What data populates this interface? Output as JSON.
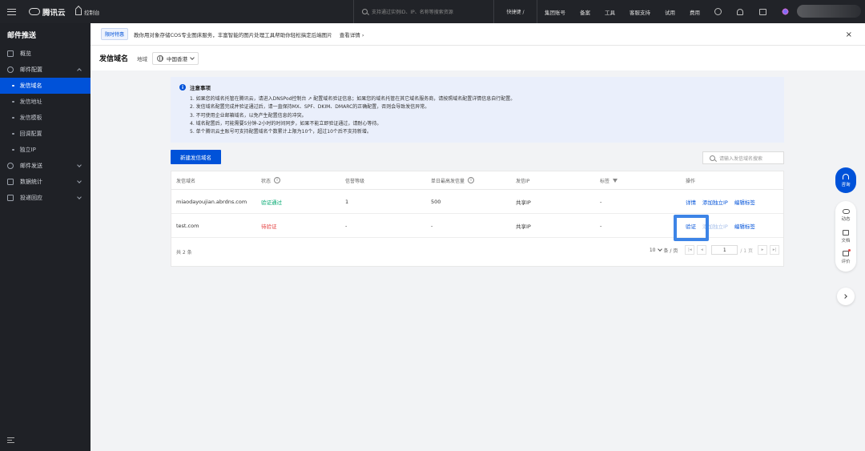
{
  "topbar": {
    "logo_text": "腾讯云",
    "console_label": "控制台",
    "search_placeholder": "支持通过实例ID、IP、名称等搜索资源",
    "user_label": "快捷键 /",
    "menu": [
      "集团账号",
      "备案",
      "工具",
      "客服支持",
      "试用",
      "费用"
    ]
  },
  "sidebar": {
    "title": "邮件推送",
    "items": {
      "overview": "概览",
      "mail_config": "邮件配置",
      "sub": [
        "发信域名",
        "发信地址",
        "发信模板",
        "回调配置"
      ],
      "dedicated_ip": "独立IP",
      "mail_send": "邮件发送",
      "data_stats": "数据统计",
      "delivery_reply": "投递回应"
    }
  },
  "notice": {
    "tag": "限时特惠",
    "text": "教你用对象存储COS专业图床服务，丰富智能的图片处理工具帮助你轻松搞定后端图片",
    "link": "查看详情 ›",
    "close": "×"
  },
  "page": {
    "title": "发信域名",
    "region_label": "地域",
    "region_value": "中国香港"
  },
  "tips": {
    "title": "注意事项",
    "lines": [
      "1. 如果您的域名托管在腾讯云，请进入DNSPod控制台 ↗ 配置域名验证信息；如果您的域名托管在其它域名服务商，请按照域名配置详情信息自行配置。",
      "2. 发信域名配置完成并验证通过后，请一直保持MX、SPF、DKIM、DMARC的正确配置，否则会导致发信异常。",
      "3. 不可使用企业邮箱域名，以免产生配置信息的冲突。",
      "4. 域名配置后，可能需要5分钟-2小时的时间同步，如果不能立即验证通过，请耐心等待。",
      "5. 单个腾讯云主账号可支持配置域名个数累计上限为10个，超过10个后不支持新增。"
    ]
  },
  "toolbar": {
    "new_button": "新建发信域名",
    "search_placeholder": "请输入发信域名搜索"
  },
  "table": {
    "headers": [
      "发信域名",
      "状态",
      "信誉等级",
      "单日最高发信量",
      "发信IP",
      "标签",
      "操作"
    ],
    "rows": [
      {
        "domain": "miaodayoujian.abrdns.com",
        "status": "验证通过",
        "reputation": "1",
        "daily_max": "500",
        "ip": "共享IP",
        "tags": "-",
        "actions": [
          "详情",
          "添加独立IP",
          "编辑标签"
        ]
      },
      {
        "domain": "test.com",
        "status": "待验证",
        "reputation": "-",
        "daily_max": "-",
        "ip": "共享IP",
        "tags": "-",
        "actions": [
          "验证",
          "添加独立IP",
          "编辑标签"
        ]
      }
    ],
    "total": "共 2 条",
    "page_size": "10",
    "page_size_unit": "条 / 页",
    "current_page": "1",
    "total_pages": "/ 1 页"
  },
  "float": {
    "consult": "咨询",
    "dynamic": "动态",
    "docs": "文档",
    "review": "评价"
  },
  "colors": {
    "primary": "#0052d9",
    "success": "#00a870",
    "danger": "#e54545",
    "highlight_box": "#3d84e6"
  }
}
